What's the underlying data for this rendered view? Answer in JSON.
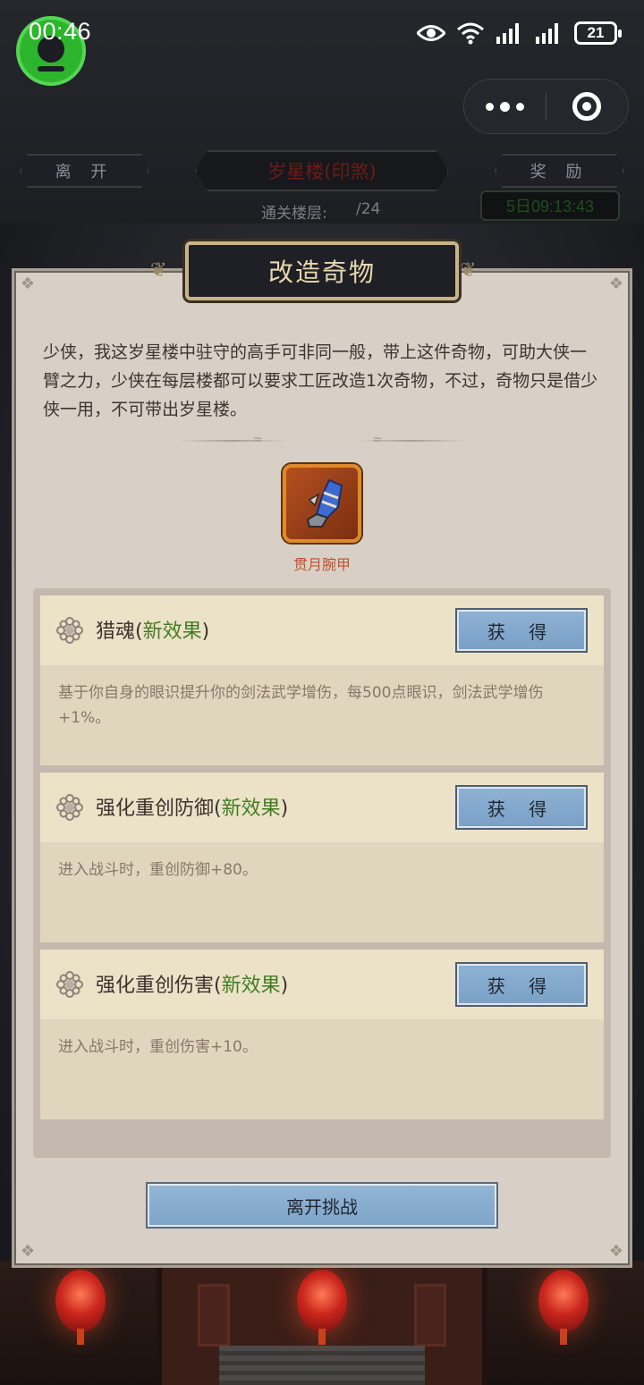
{
  "status_bar": {
    "time": "00:46",
    "battery": "21",
    "icons": [
      "eye-icon",
      "wifi-icon",
      "signal-icon",
      "signal-icon"
    ]
  },
  "header": {
    "leave_label": "离 开",
    "tower_title": "岁星楼(印煞)",
    "reward_label": "奖 励",
    "floor_label": "通关楼层:",
    "floor_value": "/24",
    "timer": "5日09:13:43"
  },
  "dialog": {
    "title": "改造奇物",
    "intro": "少侠，我这岁星楼中驻守的高手可非同一般，带上这件奇物，可助大侠一臂之力，少侠在每层楼都可以要求工匠改造1次奇物，不过，奇物只是借少侠一用，不可带出岁星楼。",
    "item_name": "贯月腕甲",
    "effects": [
      {
        "name": "猎魂",
        "tag": "新效果",
        "button": "获 得",
        "desc": "基于你自身的眼识提升你的剑法武学增伤，每500点眼识，剑法武学增伤+1%。"
      },
      {
        "name": "强化重创防御",
        "tag": "新效果",
        "button": "获 得",
        "desc": "进入战斗时，重创防御+80。"
      },
      {
        "name": "强化重创伤害",
        "tag": "新效果",
        "button": "获 得",
        "desc": "进入战斗时，重创伤害+10。"
      }
    ],
    "exit_button": "离开挑战"
  },
  "colors": {
    "accent_green": "#3f7d22",
    "item_name": "#c2502a",
    "button_blue": "#7ea4c8",
    "dialog_bg": "#d8d0c6"
  }
}
